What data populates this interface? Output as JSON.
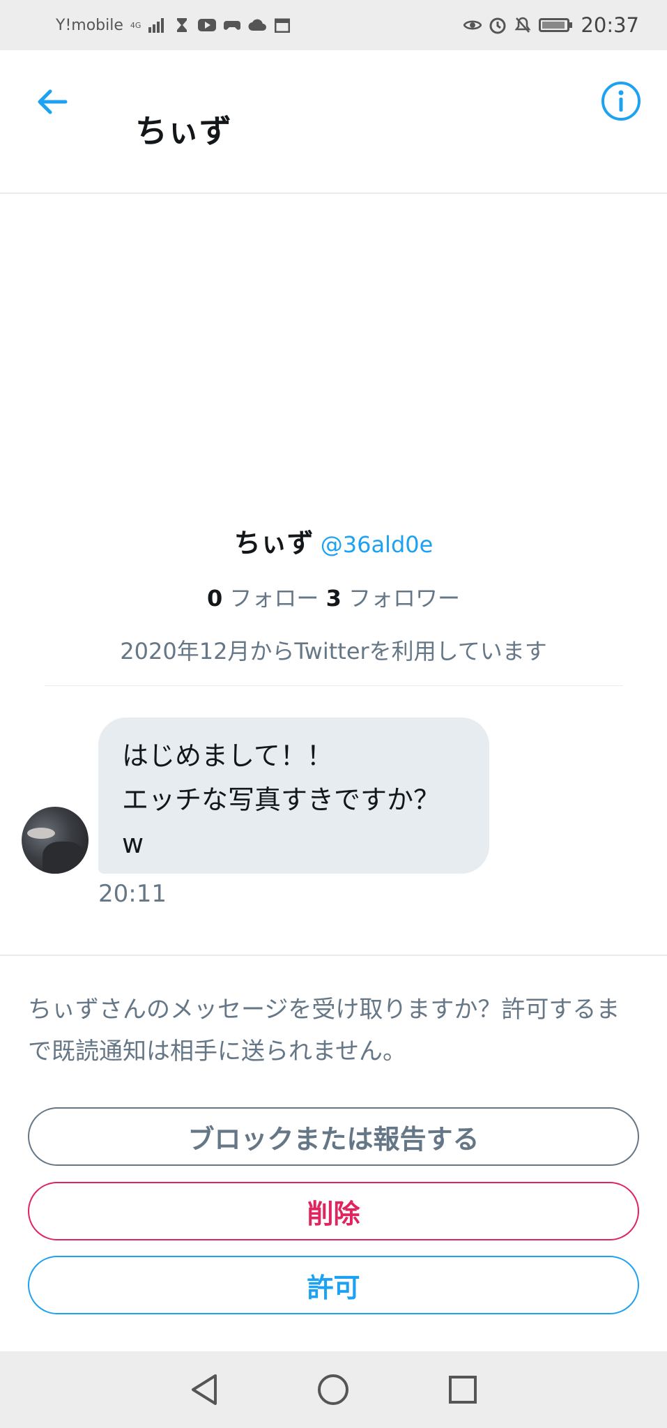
{
  "status_bar": {
    "carrier": "Y!mobile",
    "network": "4G",
    "time": "20:37"
  },
  "header": {
    "title": "ちぃず"
  },
  "profile": {
    "name": "ちぃず",
    "handle": "@36ald0e",
    "following_count": "0",
    "following_label": "フォロー",
    "followers_count": "3",
    "followers_label": "フォロワー",
    "joined": "2020年12月からTwitterを利用しています"
  },
  "message": {
    "lines": [
      "はじめまして！！",
      "エッチな写真すきですか？",
      "w"
    ],
    "time": "20:11"
  },
  "request": {
    "prompt": "ちぃずさんのメッセージを受け取りますか？許可するまで既読通知は相手に送られません。",
    "block_label": "ブロックまたは報告する",
    "delete_label": "削除",
    "allow_label": "許可"
  },
  "colors": {
    "accent": "#1da1f2",
    "danger": "#e0245e",
    "muted": "#657786",
    "bubble": "#e6ecf0"
  },
  "icons": {
    "back": "arrow-left-icon",
    "info": "info-icon",
    "nav_back": "triangle-back-icon",
    "nav_home": "circle-home-icon",
    "nav_recents": "square-recents-icon"
  }
}
